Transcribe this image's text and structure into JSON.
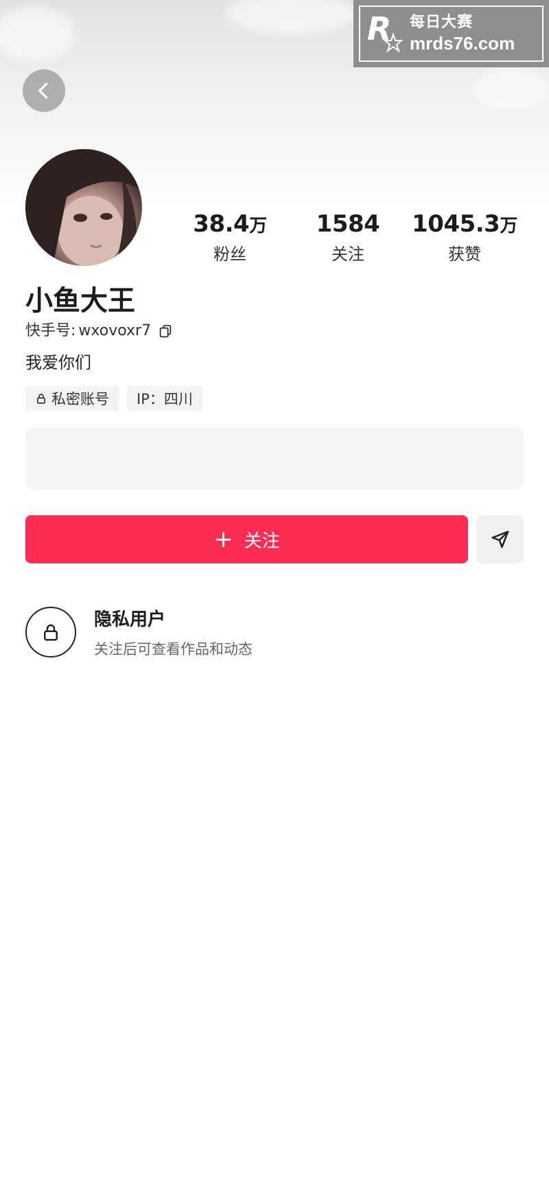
{
  "watermark": {
    "text_cn": "每日大赛",
    "url": "mrds76.com"
  },
  "profile": {
    "name": "小鱼大王",
    "id_label": "快手号:",
    "id_value": "wxovoxr7",
    "bio": "我爱你们",
    "tags": [
      {
        "label": "私密账号",
        "icon": "lock-icon"
      },
      {
        "label": "IP：四川"
      }
    ]
  },
  "stats": {
    "fans": {
      "value": "38.4",
      "unit": "万",
      "label": "粉丝"
    },
    "following": {
      "value": "1584",
      "unit": "",
      "label": "关注"
    },
    "likes": {
      "value": "1045.3",
      "unit": "万",
      "label": "获赞"
    }
  },
  "actions": {
    "follow_label": "关注",
    "follow_icon": "plus-icon",
    "message_icon": "send-icon",
    "back_icon": "chevron-left-icon"
  },
  "private_notice": {
    "title": "隐私用户",
    "subtitle": "关注后可查看作品和动态"
  },
  "colors": {
    "accent": "#fe2c55",
    "panel": "#f5f5f5"
  }
}
